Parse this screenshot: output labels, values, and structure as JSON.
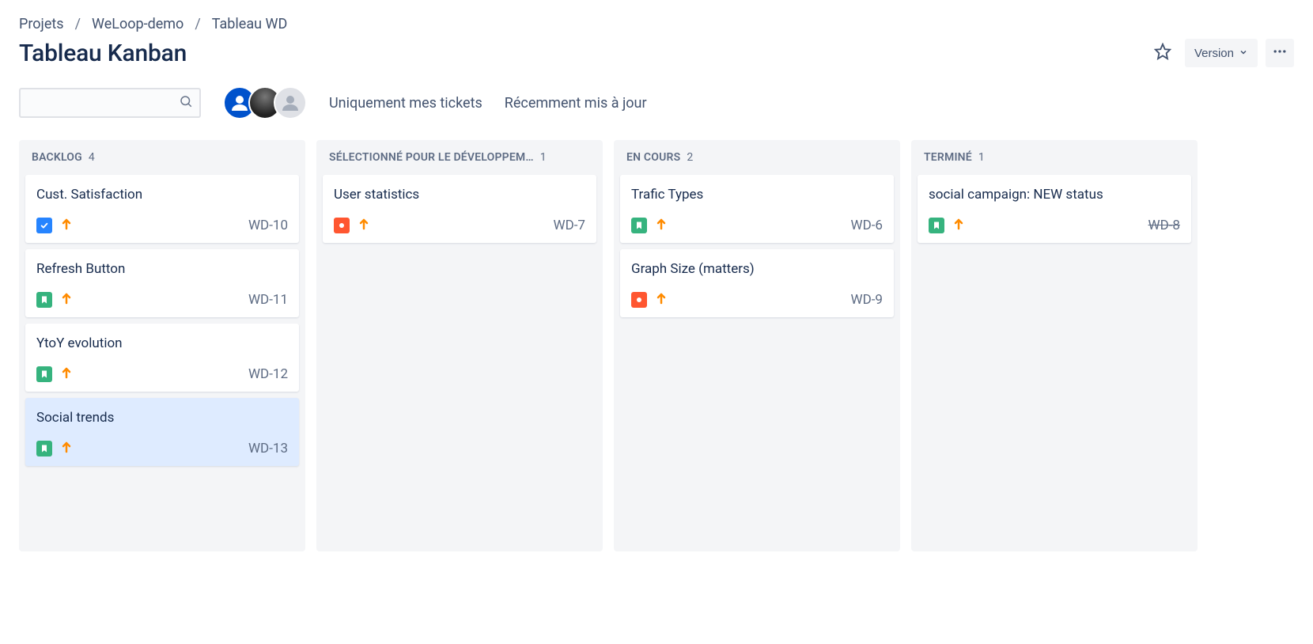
{
  "breadcrumb": {
    "items": [
      "Projets",
      "WeLoop-demo",
      "Tableau WD"
    ]
  },
  "page_title": "Tableau Kanban",
  "actions": {
    "version_label": "Version"
  },
  "filters": {
    "my_tickets": "Uniquement mes tickets",
    "recently_updated": "Récemment mis à jour"
  },
  "columns": [
    {
      "title": "Backlog",
      "count": "4",
      "cards": [
        {
          "title": "Cust. Satisfaction",
          "key": "WD-10",
          "type": "task",
          "done": false,
          "selected": false
        },
        {
          "title": "Refresh Button",
          "key": "WD-11",
          "type": "story",
          "done": false,
          "selected": false
        },
        {
          "title": "YtoY evolution",
          "key": "WD-12",
          "type": "story",
          "done": false,
          "selected": false
        },
        {
          "title": "Social trends",
          "key": "WD-13",
          "type": "story",
          "done": false,
          "selected": true
        }
      ]
    },
    {
      "title": "Sélectionné pour le développem…",
      "count": "1",
      "cards": [
        {
          "title": "User statistics",
          "key": "WD-7",
          "type": "bug",
          "done": false,
          "selected": false
        }
      ]
    },
    {
      "title": "En cours",
      "count": "2",
      "cards": [
        {
          "title": "Trafic Types",
          "key": "WD-6",
          "type": "story",
          "done": false,
          "selected": false
        },
        {
          "title": "Graph Size (matters)",
          "key": "WD-9",
          "type": "bug",
          "done": false,
          "selected": false
        }
      ]
    },
    {
      "title": "Terminé",
      "count": "1",
      "cards": [
        {
          "title": "social campaign: NEW status",
          "key": "WD-8",
          "type": "story",
          "done": true,
          "selected": false
        }
      ]
    }
  ]
}
